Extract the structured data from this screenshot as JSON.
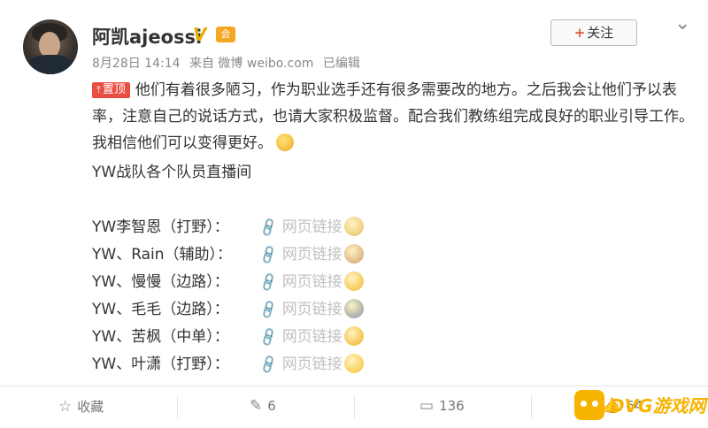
{
  "user": {
    "name": "阿凯ajeossi",
    "verify_mark": "V",
    "vip_mark": "会",
    "meta_date": "8月28日 14:14",
    "meta_source": "来自 微博 weibo.com",
    "meta_edited": "已编辑"
  },
  "header": {
    "follow_plus": "+",
    "follow_label": "关注",
    "more_icon": "⌄"
  },
  "post": {
    "pin_label": "置顶",
    "body": "他们有着很多陋习，作为职业选手还有很多需要改的地方。之后我会让他们予以表率，注意自己的说话方式，也请大家积极监督。配合我们教练组完成良好的职业引导工作。我相信他们可以变得更好。",
    "team_line": "YW战队各个队员直播间"
  },
  "players": [
    {
      "name": "YW李智恩（打野）：",
      "link": "网页链接",
      "emoji_color": "#e6c060"
    },
    {
      "name": "YW、Rain（辅助）：",
      "link": "网页链接",
      "emoji_color": "#d09a70"
    },
    {
      "name": "YW、慢慢（边路）：",
      "link": "网页链接",
      "emoji_color": "#f2b830"
    },
    {
      "name": "YW、毛毛（边路）：",
      "link": "网页链接",
      "emoji_color": "#8090a8"
    },
    {
      "name": "YW、苦枫（中单）：",
      "link": "网页链接",
      "emoji_color": "#f0b020"
    },
    {
      "name": "YW、叶潇（打野）：",
      "link": "网页链接",
      "emoji_color": "#f5c030"
    }
  ],
  "footer": {
    "favorite_label": "收藏",
    "repost_count": "6",
    "comment_count": "136",
    "like_count": "64"
  },
  "watermark": {
    "text": "DVG游戏网"
  }
}
